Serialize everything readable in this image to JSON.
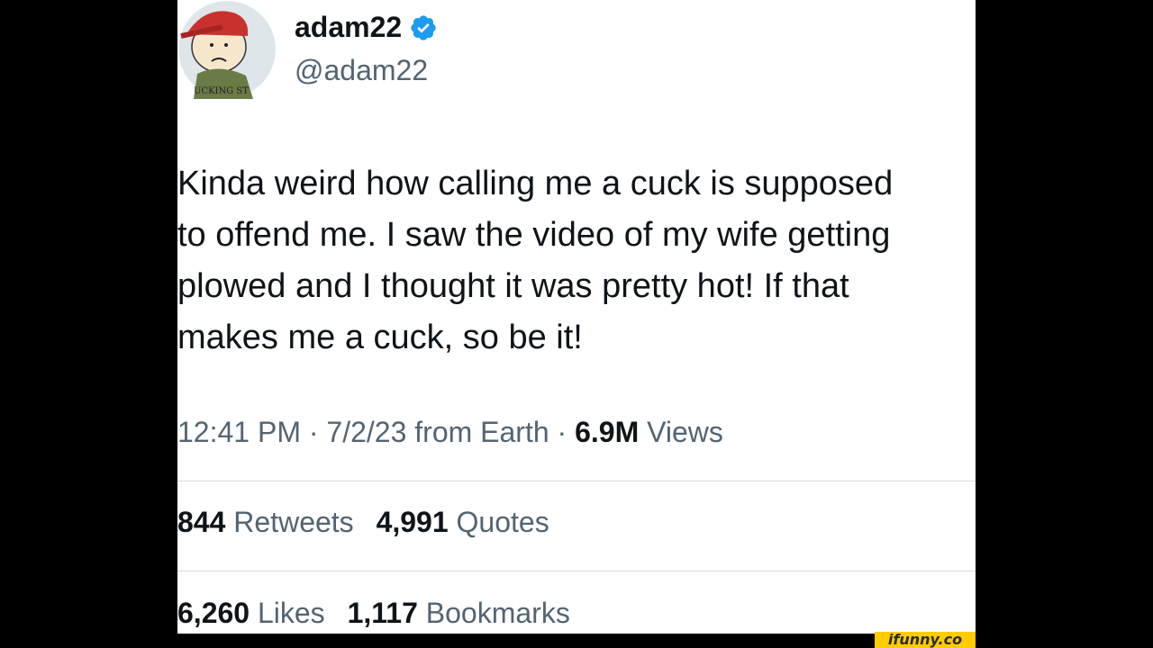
{
  "tweet": {
    "display_name": "adam22",
    "handle": "@adam22",
    "avatar_caption": "UCKING ST",
    "text": "Kinda weird how calling me a cuck is supposed\nto offend me. I saw the video of my wife getting\nplowed and I thought it was pretty hot! If that\nmakes me a cuck, so be it!",
    "time": "12:41 PM",
    "date": "7/2/23",
    "source": "from Earth",
    "separator": "·",
    "views_count": "6.9M",
    "views_label": "Views"
  },
  "stats": {
    "retweets": {
      "count": "844",
      "label": "Retweets"
    },
    "quotes": {
      "count": "4,991",
      "label": "Quotes"
    },
    "likes": {
      "count": "6,260",
      "label": "Likes"
    },
    "bookmarks": {
      "count": "1,117",
      "label": "Bookmarks"
    }
  },
  "watermark": "ifunny.co",
  "colors": {
    "background": "#000000",
    "card": "#ffffff",
    "primary_text": "#0f1419",
    "secondary_text": "#536471",
    "verified": "#1d9bf0",
    "watermark_bg": "#ffcc00"
  },
  "icons": [
    "avatar",
    "verified-badge-icon"
  ]
}
